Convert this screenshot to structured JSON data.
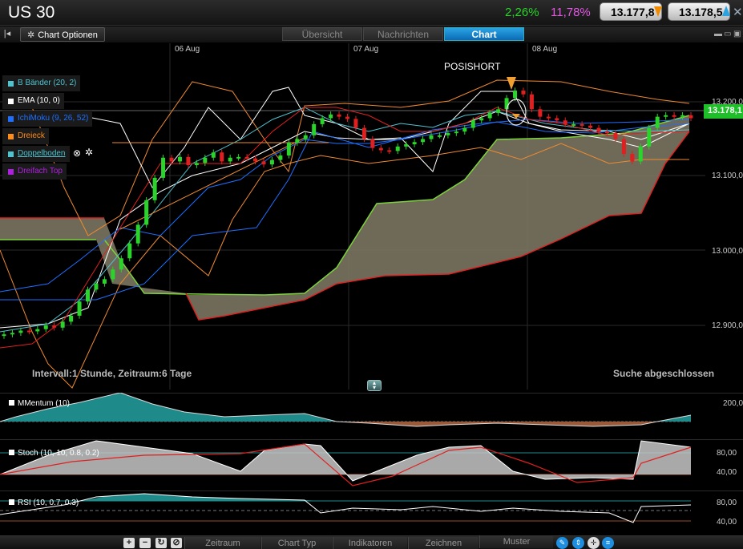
{
  "header": {
    "title": "US 30",
    "change_1": "2,26%",
    "change_2": "11,78%",
    "bid": "13.177,8",
    "ask": "13.178,5",
    "close_icon": "close-icon"
  },
  "toolbar": {
    "back_icon": "back-icon",
    "chart_options_label": "Chart Optionen",
    "tabs": [
      {
        "label": "Übersicht",
        "active": false
      },
      {
        "label": "Nachrichten",
        "active": false
      },
      {
        "label": "Chart",
        "active": true
      }
    ]
  },
  "main": {
    "dates": [
      "06 Aug",
      "07 Aug",
      "08 Aug"
    ],
    "price_labels": [
      "13.200,0",
      "13.100,0",
      "13.000,0",
      "12.900,0"
    ],
    "current_price": "13.178,1",
    "annotation": "POSISHORT",
    "interval_text": "Intervall:1 Stunde, Zeitraum:6 Tage",
    "status_text": "Suche abgeschlossen",
    "legend": [
      {
        "label": "B Bänder (20, 2)",
        "color": "#4fc3d0"
      },
      {
        "label": "EMA (10, 0)",
        "color": "#ffffff"
      },
      {
        "label": "IchiMoku (9, 26, 52)",
        "color": "#1e6fff"
      },
      {
        "label": "Dreieck",
        "color": "#ff8c1a"
      },
      {
        "label": "Doppelboden",
        "color": "#4fc3d0"
      },
      {
        "label": "Dreifach Top",
        "color": "#b020e0"
      }
    ]
  },
  "indicators": {
    "momentum": {
      "label": "MMentum (10)",
      "level": "200,0"
    },
    "stoch": {
      "label": "Stoch (10, 10, 0.8, 0.2)",
      "levels": [
        "80,00",
        "40,00"
      ]
    },
    "rsi": {
      "label": "RSI (10, 0.7, 0.3)",
      "levels": [
        "80,00",
        "40,00"
      ]
    }
  },
  "bottom": {
    "buttons": [
      "+",
      "−"
    ],
    "tabs": [
      "Zeitraum",
      "Chart Typ",
      "Indikatoren",
      "Zeichnen",
      "Muster"
    ]
  },
  "chart_data": {
    "type": "candlestick",
    "title": "US 30",
    "interval": "1 Stunde",
    "x_dates": [
      "06 Aug",
      "07 Aug",
      "08 Aug"
    ],
    "ylim": [
      12850,
      13250
    ],
    "y_ticks": [
      12900,
      13000,
      13100,
      13200
    ],
    "last_price": 13178.1,
    "close": [
      12888,
      12890,
      12893,
      12892,
      12895,
      12900,
      12897,
      12905,
      12913,
      12932,
      12948,
      12956,
      12962,
      12975,
      12990,
      13010,
      13035,
      13068,
      13098,
      13125,
      13120,
      13126,
      13115,
      13118,
      13125,
      13132,
      13120,
      13125,
      13126,
      13124,
      13120,
      13116,
      13122,
      13128,
      13145,
      13150,
      13155,
      13170,
      13178,
      13183,
      13180,
      13177,
      13165,
      13150,
      13138,
      13135,
      13134,
      13140,
      13143,
      13146,
      13150,
      13155,
      13155,
      13158,
      13160,
      13165,
      13175,
      13178,
      13185,
      13190,
      13205,
      13215,
      13210,
      13190,
      13180,
      13178,
      13175,
      13170,
      13170,
      13168,
      13165,
      13160,
      13158,
      13150,
      13130,
      13120,
      13140,
      13165,
      13180,
      13182,
      13180,
      13182,
      13178
    ]
  }
}
